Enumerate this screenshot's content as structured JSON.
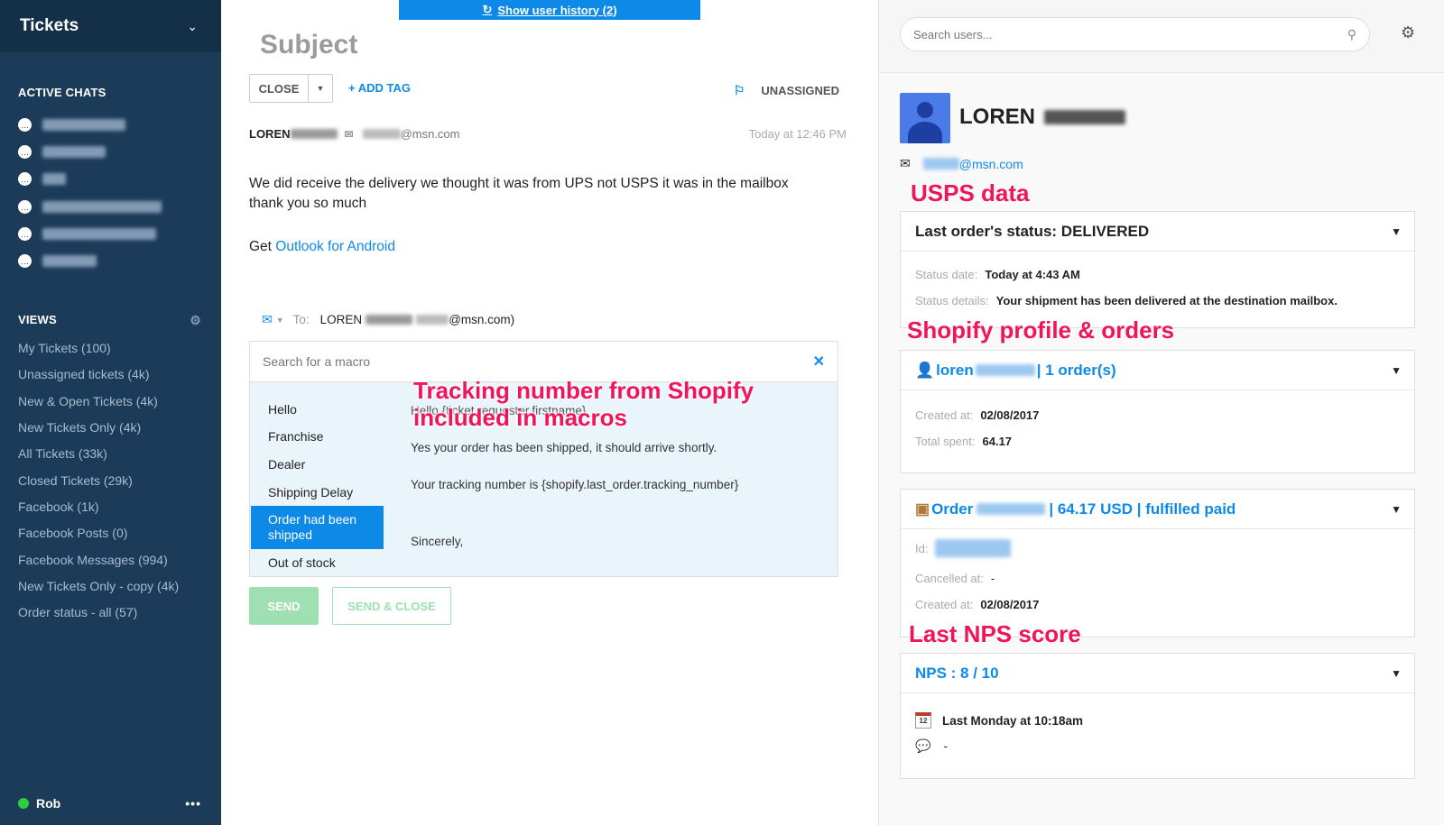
{
  "sidebar": {
    "title": "Tickets",
    "active_chats_label": "ACTIVE CHATS",
    "views_label": "VIEWS",
    "views": [
      "My Tickets (100)",
      "Unassigned tickets (4k)",
      "New & Open Tickets (4k)",
      "New Tickets Only (4k)",
      "All Tickets (33k)",
      "Closed Tickets (29k)",
      "Facebook (1k)",
      "Facebook Posts (0)",
      "Facebook Messages (994)",
      "New Tickets Only - copy (4k)",
      "Order status - all (57)"
    ],
    "user": "Rob",
    "more": "•••"
  },
  "ticket": {
    "history_button": "Show user history (2)",
    "subject": "Subject",
    "close_label": "CLOSE",
    "add_tag_label": "ADD TAG",
    "assignee": "UNASSIGNED",
    "sender_name": "LOREN",
    "sender_email_suffix": "@msn.com",
    "timestamp": "Today at 12:46 PM",
    "body": "We did receive the delivery we thought it was from UPS not USPS it was in the mailbox thank you so much",
    "get_prefix": "Get ",
    "get_link": "Outlook for Android",
    "reply_to_label": "To:",
    "reply_to_name": "LOREN",
    "reply_to_email_suffix": "@msn.com)",
    "macro_search_placeholder": "Search for a macro",
    "macros": [
      "Hello",
      "Franchise",
      "Dealer",
      "Shipping Delay",
      "Order had been shipped",
      "Out of stock"
    ],
    "preview": {
      "line1": "Hello {ticket.requester.firstname},",
      "line2": "Yes your order has been shipped, it should arrive shortly.",
      "line3": "Your tracking number is {shopify.last_order.tracking_number}",
      "line4": "Sincerely,"
    },
    "send_label": "SEND",
    "send_close_label": "SEND & CLOSE"
  },
  "annotations": {
    "tracking": "Tracking number from Shopify included in macros",
    "usps": "USPS data",
    "shopify": "Shopify profile & orders",
    "nps": "Last NPS score"
  },
  "customer": {
    "search_placeholder": "Search users...",
    "name": "LOREN",
    "email_suffix": "@msn.com",
    "usps_card": {
      "title": "Last order's status: DELIVERED",
      "status_date_label": "Status date:",
      "status_date": "Today at 4:43 AM",
      "status_details_label": "Status details:",
      "status_details": "Your shipment has been delivered at the destination mailbox."
    },
    "shopify_card": {
      "title_prefix": "loren",
      "title_suffix": "| 1 order(s)",
      "created_label": "Created at:",
      "created": "02/08/2017",
      "spent_label": "Total spent:",
      "spent": "64.17"
    },
    "order_card": {
      "title_prefix": "Order",
      "title_suffix": "| 64.17 USD | fulfilled paid",
      "id_label": "Id:",
      "cancelled_label": "Cancelled at:",
      "cancelled": "-",
      "created_label": "Created at:",
      "created": "02/08/2017"
    },
    "nps_card": {
      "title": "NPS : 8 / 10",
      "date": "Last Monday at 10:18am",
      "comment": "-"
    }
  },
  "colors": {
    "sidebar": "#1b3b59",
    "accent": "#0d8ae8",
    "send": "#9ee0b2",
    "annotation": "#f0145a"
  }
}
